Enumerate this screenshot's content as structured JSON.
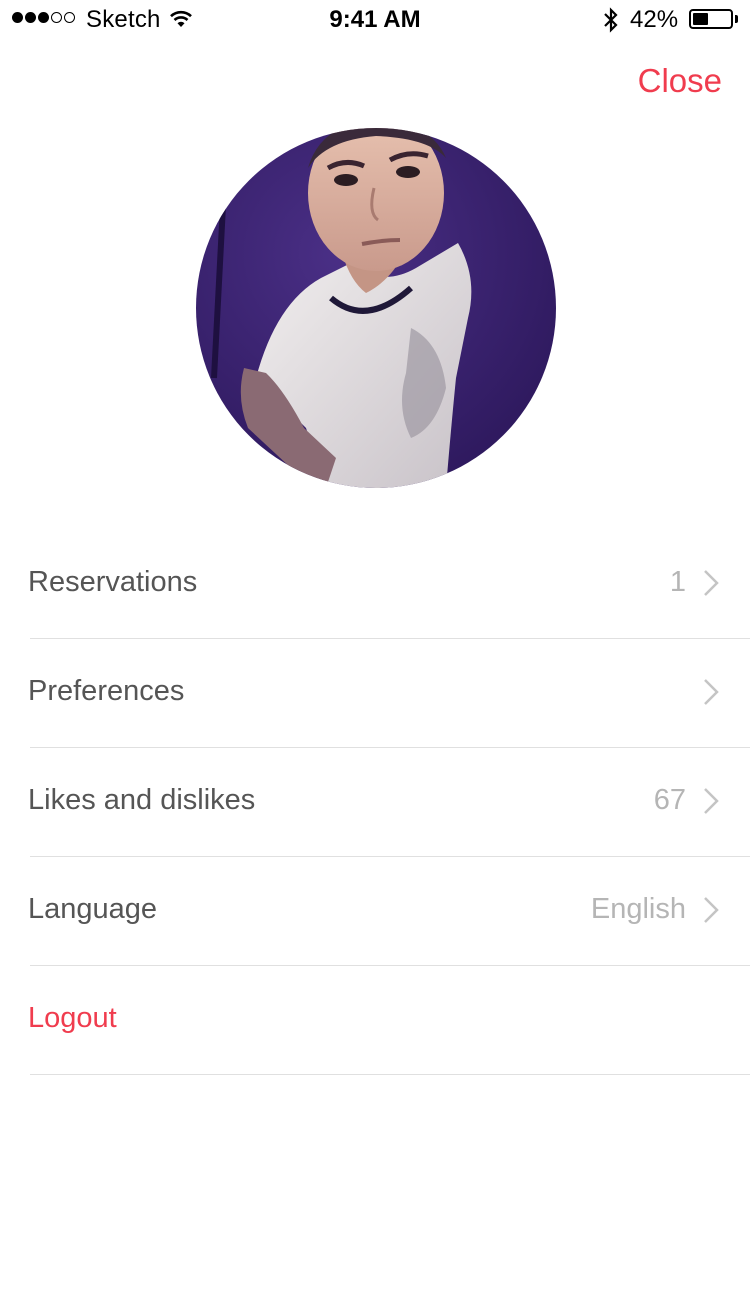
{
  "status_bar": {
    "signal_bars_filled": 3,
    "signal_bars_total": 5,
    "carrier": "Sketch",
    "time": "9:41 AM",
    "battery_percent": "42%",
    "battery_level": 0.42
  },
  "header": {
    "close_label": "Close"
  },
  "profile": {
    "avatar_icon": "user-avatar-photo"
  },
  "menu": {
    "items": [
      {
        "label": "Reservations",
        "value": "1"
      },
      {
        "label": "Preferences",
        "value": ""
      },
      {
        "label": "Likes and dislikes",
        "value": "67"
      },
      {
        "label": "Language",
        "value": "English"
      }
    ],
    "logout_label": "Logout"
  },
  "colors": {
    "accent": "#f03c4e",
    "label": "#555555",
    "value": "#b5b5b5",
    "divider": "#e0e0e0"
  }
}
